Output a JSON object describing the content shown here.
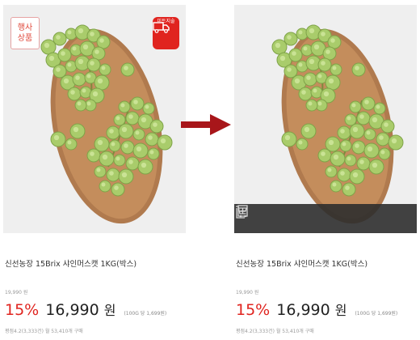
{
  "badges": {
    "event_line1": "행사",
    "event_line2": "상품",
    "delivery": "미트지술"
  },
  "product": {
    "title": "신선농장 15Brix 샤인머스캣 1KG(박스)",
    "original_price": "19,990 원",
    "discount": "15%",
    "price": "16,990",
    "currency": "원",
    "unit_price": "(100G 당 1,699원)",
    "rating_text": "평점4.2(3,333건) 월 53,410개 구매"
  },
  "hover_actions": {
    "cart_icon": "cart-icon",
    "add_icon": "add-to-list-icon"
  },
  "colors": {
    "accent_red": "#e0241f",
    "arrow": "#a8161a"
  }
}
